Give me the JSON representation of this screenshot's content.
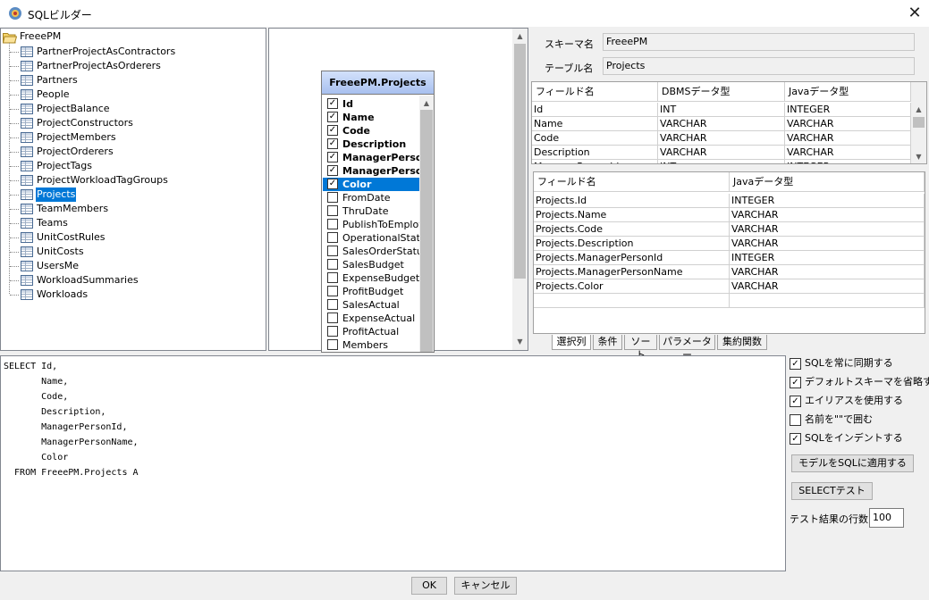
{
  "window": {
    "title": "SQLビルダー",
    "close_glyph": "✕"
  },
  "tree": {
    "root": "FreeePM",
    "tables": [
      "PartnerProjectAsContractors",
      "PartnerProjectAsOrderers",
      "Partners",
      "People",
      "ProjectBalance",
      "ProjectConstructors",
      "ProjectMembers",
      "ProjectOrderers",
      "ProjectTags",
      "ProjectWorkloadTagGroups",
      "Projects",
      "TeamMembers",
      "Teams",
      "UnitCostRules",
      "UnitCosts",
      "UsersMe",
      "WorkloadSummaries",
      "Workloads"
    ],
    "selected": "Projects"
  },
  "entity": {
    "title": "FreeePM.Projects",
    "fields": [
      {
        "name": "Id",
        "checked": true
      },
      {
        "name": "Name",
        "checked": true
      },
      {
        "name": "Code",
        "checked": true
      },
      {
        "name": "Description",
        "checked": true
      },
      {
        "name": "ManagerPerson",
        "checked": true
      },
      {
        "name": "ManagerPerson",
        "checked": true
      },
      {
        "name": "Color",
        "checked": true
      },
      {
        "name": "FromDate",
        "checked": false
      },
      {
        "name": "ThruDate",
        "checked": false
      },
      {
        "name": "PublishToEmploy",
        "checked": false
      },
      {
        "name": "OperationalStatu",
        "checked": false
      },
      {
        "name": "SalesOrderStatu",
        "checked": false
      },
      {
        "name": "SalesBudget",
        "checked": false
      },
      {
        "name": "ExpenseBudget",
        "checked": false
      },
      {
        "name": "ProfitBudget",
        "checked": false
      },
      {
        "name": "SalesActual",
        "checked": false
      },
      {
        "name": "ExpenseActual",
        "checked": false
      },
      {
        "name": "ProfitActual",
        "checked": false
      },
      {
        "name": "Members",
        "checked": false
      }
    ],
    "selected_index": 6
  },
  "form": {
    "schema_label": "スキーマ名",
    "schema_value": "FreeePM",
    "table_label": "テーブル名",
    "table_value": "Projects"
  },
  "field_grid": {
    "headers": [
      "フィールド名",
      "DBMSデータ型",
      "Javaデータ型"
    ],
    "rows": [
      [
        "Id",
        "INT",
        "INTEGER"
      ],
      [
        "Name",
        "VARCHAR",
        "VARCHAR"
      ],
      [
        "Code",
        "VARCHAR",
        "VARCHAR"
      ],
      [
        "Description",
        "VARCHAR",
        "VARCHAR"
      ],
      [
        "ManagerPersonId",
        "INT",
        "INTEGER"
      ]
    ]
  },
  "selected_grid": {
    "headers": [
      "フィールド名",
      "Javaデータ型"
    ],
    "rows": [
      [
        "Projects.Id",
        "INTEGER"
      ],
      [
        "Projects.Name",
        "VARCHAR"
      ],
      [
        "Projects.Code",
        "VARCHAR"
      ],
      [
        "Projects.Description",
        "VARCHAR"
      ],
      [
        "Projects.ManagerPersonId",
        "INTEGER"
      ],
      [
        "Projects.ManagerPersonName",
        "VARCHAR"
      ],
      [
        "Projects.Color",
        "VARCHAR"
      ]
    ]
  },
  "tabs": [
    "選択列",
    "条件",
    "ソート",
    "パラメーター",
    "集約関数"
  ],
  "sql": "SELECT Id,\n       Name,\n       Code,\n       Description,\n       ManagerPersonId,\n       ManagerPersonName,\n       Color\n  FROM FreeePM.Projects A",
  "options": [
    {
      "label": "SQLを常に同期する",
      "checked": true
    },
    {
      "label": "デフォルトスキーマを省略する",
      "checked": true
    },
    {
      "label": "エイリアスを使用する",
      "checked": true
    },
    {
      "label": "名前を\"\"で囲む",
      "checked": false
    },
    {
      "label": "SQLをインデントする",
      "checked": true
    }
  ],
  "buttons": {
    "apply_model": "モデルをSQLに適用する",
    "select_test": "SELECTテスト",
    "ok": "OK",
    "cancel": "キャンセル"
  },
  "test_rows": {
    "label": "テスト結果の行数",
    "value": "100"
  },
  "colors": {
    "selection": "#0078d7",
    "entity_header": "#a8c0ef"
  }
}
